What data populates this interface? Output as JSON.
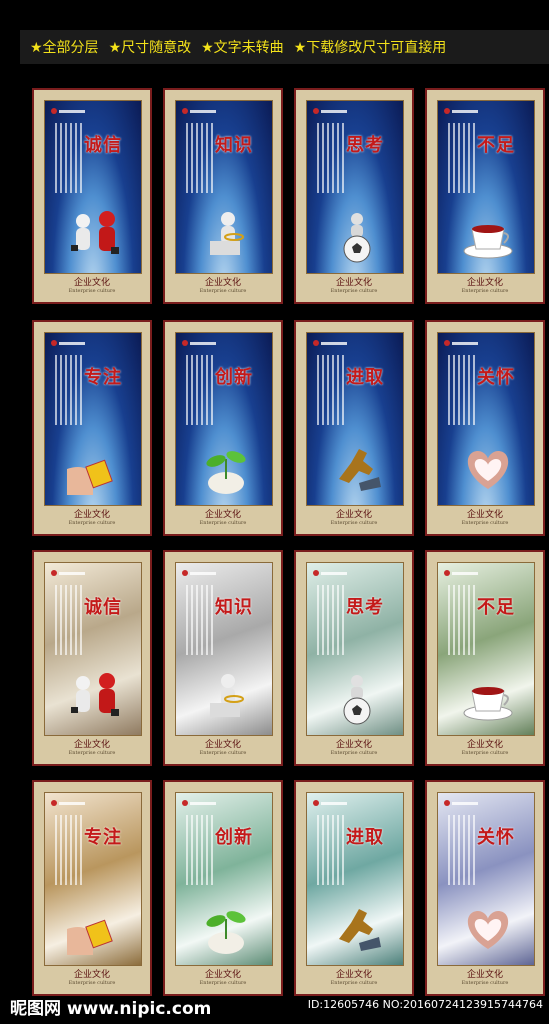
{
  "header": {
    "items": [
      "★全部分层",
      "★尺寸随意改",
      "★文字未转曲",
      "★下载修改尺寸可直接用"
    ]
  },
  "posters": [
    {
      "title": "诚信",
      "footer": "企业文化",
      "sub": "Enterprise culture",
      "theme": "space",
      "pic": "handshake"
    },
    {
      "title": "知识",
      "footer": "企业文化",
      "sub": "Enterprise culture",
      "theme": "space",
      "pic": "figure"
    },
    {
      "title": "思考",
      "footer": "企业文化",
      "sub": "Enterprise culture",
      "theme": "space",
      "pic": "ball"
    },
    {
      "title": "不足",
      "footer": "企业文化",
      "sub": "Enterprise culture",
      "theme": "space",
      "pic": "cup"
    },
    {
      "title": "专注",
      "footer": "企业文化",
      "sub": "Enterprise culture",
      "theme": "space",
      "pic": "hand"
    },
    {
      "title": "创新",
      "footer": "企业文化",
      "sub": "Enterprise culture",
      "theme": "space",
      "pic": "sprout"
    },
    {
      "title": "进取",
      "footer": "企业文化",
      "sub": "Enterprise culture",
      "theme": "space",
      "pic": "horse"
    },
    {
      "title": "关怀",
      "footer": "企业文化",
      "sub": "Enterprise culture",
      "theme": "space",
      "pic": "heart"
    },
    {
      "title": "诚信",
      "footer": "企业文化",
      "sub": "Enterprise culture",
      "theme": "ink",
      "pic": "handshake"
    },
    {
      "title": "知识",
      "footer": "企业文化",
      "sub": "Enterprise culture",
      "theme": "ink",
      "pic": "figure"
    },
    {
      "title": "思考",
      "footer": "企业文化",
      "sub": "Enterprise culture",
      "theme": "ink",
      "pic": "ball"
    },
    {
      "title": "不足",
      "footer": "企业文化",
      "sub": "Enterprise culture",
      "theme": "ink",
      "pic": "cup"
    },
    {
      "title": "专注",
      "footer": "企业文化",
      "sub": "Enterprise culture",
      "theme": "ink",
      "pic": "hand"
    },
    {
      "title": "创新",
      "footer": "企业文化",
      "sub": "Enterprise culture",
      "theme": "ink",
      "pic": "sprout"
    },
    {
      "title": "进取",
      "footer": "企业文化",
      "sub": "Enterprise culture",
      "theme": "ink",
      "pic": "horse"
    },
    {
      "title": "关怀",
      "footer": "企业文化",
      "sub": "Enterprise culture",
      "theme": "ink",
      "pic": "heart"
    }
  ],
  "watermark": {
    "left": "昵图网 www.nipic.com",
    "right": "ID:12605746 NO:20160724123915744764"
  },
  "colors": {
    "header_text": "#f3e21a",
    "frame": "#d8c9a4",
    "border": "#7a1d1d",
    "title": "#c41a1a"
  }
}
